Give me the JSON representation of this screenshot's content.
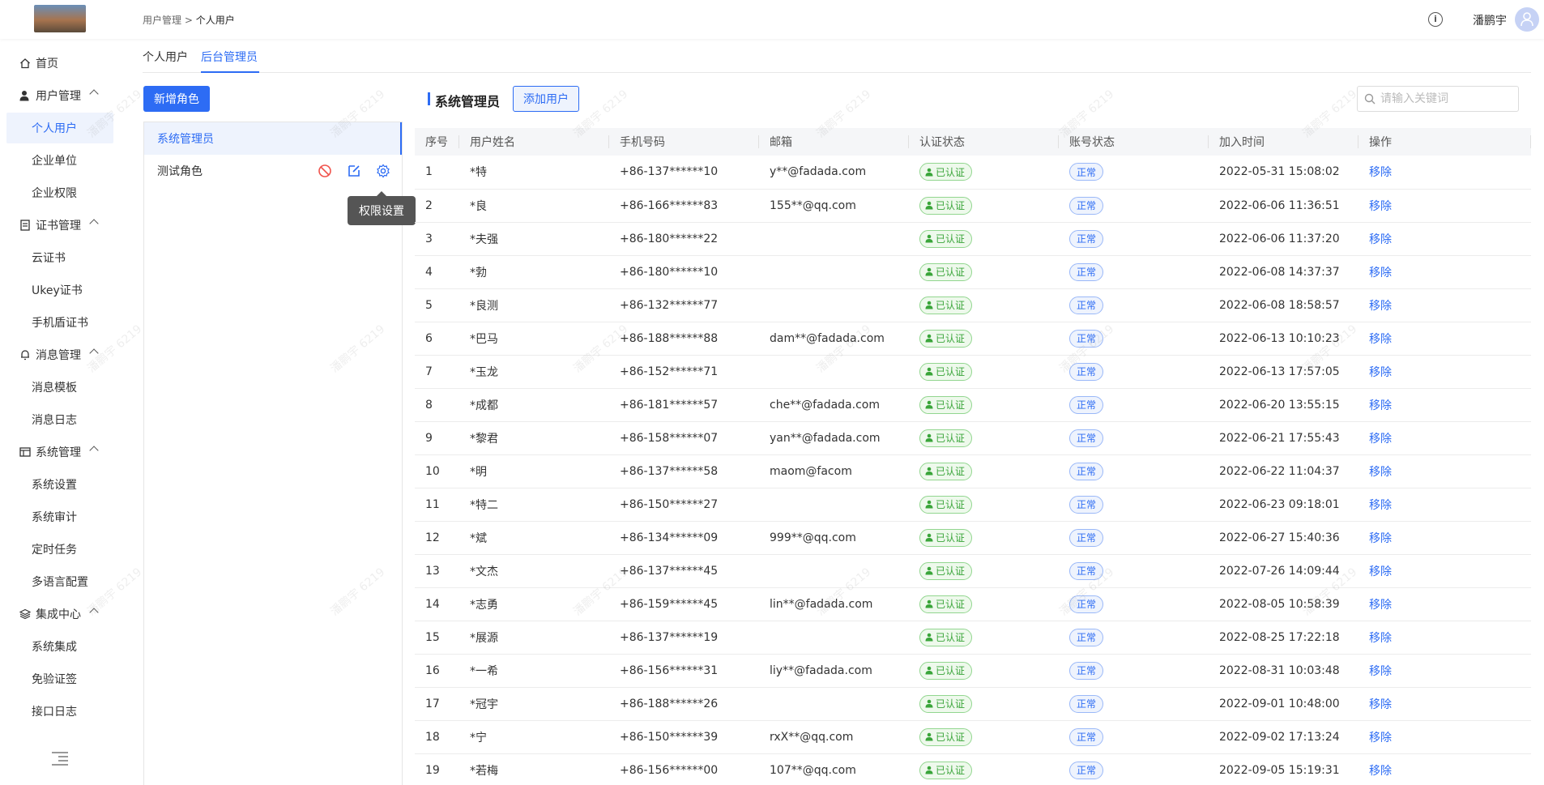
{
  "header": {
    "breadcrumb_parent": "用户管理",
    "breadcrumb_sep": ">",
    "breadcrumb_current": "个人用户",
    "user_name": "潘鹏宇"
  },
  "sidebar": {
    "items": [
      {
        "label": "首页",
        "level": "top",
        "icon": "home-icon"
      },
      {
        "label": "用户管理",
        "level": "top",
        "icon": "user-icon",
        "expanded": true
      },
      {
        "label": "个人用户",
        "level": "sub",
        "active": true
      },
      {
        "label": "企业单位",
        "level": "sub"
      },
      {
        "label": "企业权限",
        "level": "sub"
      },
      {
        "label": "证书管理",
        "level": "top",
        "icon": "certificate-icon",
        "expanded": true
      },
      {
        "label": "云证书",
        "level": "sub"
      },
      {
        "label": "Ukey证书",
        "level": "sub"
      },
      {
        "label": "手机盾证书",
        "level": "sub"
      },
      {
        "label": "消息管理",
        "level": "top",
        "icon": "bell-icon",
        "expanded": true
      },
      {
        "label": "消息模板",
        "level": "sub"
      },
      {
        "label": "消息日志",
        "level": "sub"
      },
      {
        "label": "系统管理",
        "level": "top",
        "icon": "system-icon",
        "expanded": true
      },
      {
        "label": "系统设置",
        "level": "sub"
      },
      {
        "label": "系统审计",
        "level": "sub"
      },
      {
        "label": "定时任务",
        "level": "sub"
      },
      {
        "label": "多语言配置",
        "level": "sub"
      },
      {
        "label": "集成中心",
        "level": "top",
        "icon": "layers-icon",
        "expanded": true
      },
      {
        "label": "系统集成",
        "level": "sub"
      },
      {
        "label": "免验证签",
        "level": "sub"
      },
      {
        "label": "接口日志",
        "level": "sub"
      }
    ]
  },
  "tabs": [
    {
      "label": "个人用户"
    },
    {
      "label": "后台管理员",
      "active": true
    }
  ],
  "roles": {
    "add_button": "新增角色",
    "items": [
      {
        "label": "系统管理员",
        "active": true
      },
      {
        "label": "测试角色"
      }
    ],
    "tooltip": "权限设置"
  },
  "main": {
    "section_title": "系统管理员",
    "add_user_button": "添加用户",
    "search_placeholder": "请输入关键词"
  },
  "table": {
    "columns": [
      "序号",
      "用户姓名",
      "手机号码",
      "邮箱",
      "认证状态",
      "账号状态",
      "加入时间",
      "操作"
    ],
    "rows": [
      [
        "1",
        "*特",
        "+86-137******10",
        "y**@fadada.com",
        "已认证",
        "正常",
        "2022-05-31 15:08:02",
        "移除"
      ],
      [
        "2",
        "*良",
        "+86-166******83",
        "155**@qq.com",
        "已认证",
        "正常",
        "2022-06-06 11:36:51",
        "移除"
      ],
      [
        "3",
        "*夫强",
        "+86-180******22",
        "",
        "已认证",
        "正常",
        "2022-06-06 11:37:20",
        "移除"
      ],
      [
        "4",
        "*勃",
        "+86-180******10",
        "",
        "已认证",
        "正常",
        "2022-06-08 14:37:37",
        "移除"
      ],
      [
        "5",
        "*良测",
        "+86-132******77",
        "",
        "已认证",
        "正常",
        "2022-06-08 18:58:57",
        "移除"
      ],
      [
        "6",
        "*巴马",
        "+86-188******88",
        "dam**@fadada.com",
        "已认证",
        "正常",
        "2022-06-13 10:10:23",
        "移除"
      ],
      [
        "7",
        "*玉龙",
        "+86-152******71",
        "",
        "已认证",
        "正常",
        "2022-06-13 17:57:05",
        "移除"
      ],
      [
        "8",
        "*成都",
        "+86-181******57",
        "che**@fadada.com",
        "已认证",
        "正常",
        "2022-06-20 13:55:15",
        "移除"
      ],
      [
        "9",
        "*黎君",
        "+86-158******07",
        "yan**@fadada.com",
        "已认证",
        "正常",
        "2022-06-21 17:55:43",
        "移除"
      ],
      [
        "10",
        "*明",
        "+86-137******58",
        "maom@facom",
        "已认证",
        "正常",
        "2022-06-22 11:04:37",
        "移除"
      ],
      [
        "11",
        "*特二",
        "+86-150******27",
        "",
        "已认证",
        "正常",
        "2022-06-23 09:18:01",
        "移除"
      ],
      [
        "12",
        "*斌",
        "+86-134******09",
        "999**@qq.com",
        "已认证",
        "正常",
        "2022-06-27 15:40:36",
        "移除"
      ],
      [
        "13",
        "*文杰",
        "+86-137******45",
        "",
        "已认证",
        "正常",
        "2022-07-26 14:09:44",
        "移除"
      ],
      [
        "14",
        "*志勇",
        "+86-159******45",
        "lin**@fadada.com",
        "已认证",
        "正常",
        "2022-08-05 10:58:39",
        "移除"
      ],
      [
        "15",
        "*展源",
        "+86-137******19",
        "",
        "已认证",
        "正常",
        "2022-08-25 17:22:18",
        "移除"
      ],
      [
        "16",
        "*一希",
        "+86-156******31",
        "liy**@fadada.com",
        "已认证",
        "正常",
        "2022-08-31 10:03:48",
        "移除"
      ],
      [
        "17",
        "*冠宇",
        "+86-188******26",
        "",
        "已认证",
        "正常",
        "2022-09-01 10:48:00",
        "移除"
      ],
      [
        "18",
        "*宁",
        "+86-150******39",
        "rxX**@qq.com",
        "已认证",
        "正常",
        "2022-09-02 17:13:24",
        "移除"
      ],
      [
        "19",
        "*若梅",
        "+86-156******00",
        "107**@qq.com",
        "已认证",
        "正常",
        "2022-09-05 15:19:31",
        "移除"
      ]
    ]
  },
  "watermark": "潘鹏宇 6219",
  "colors": {
    "primary": "#2d6cf4",
    "success": "#3aa53a"
  }
}
